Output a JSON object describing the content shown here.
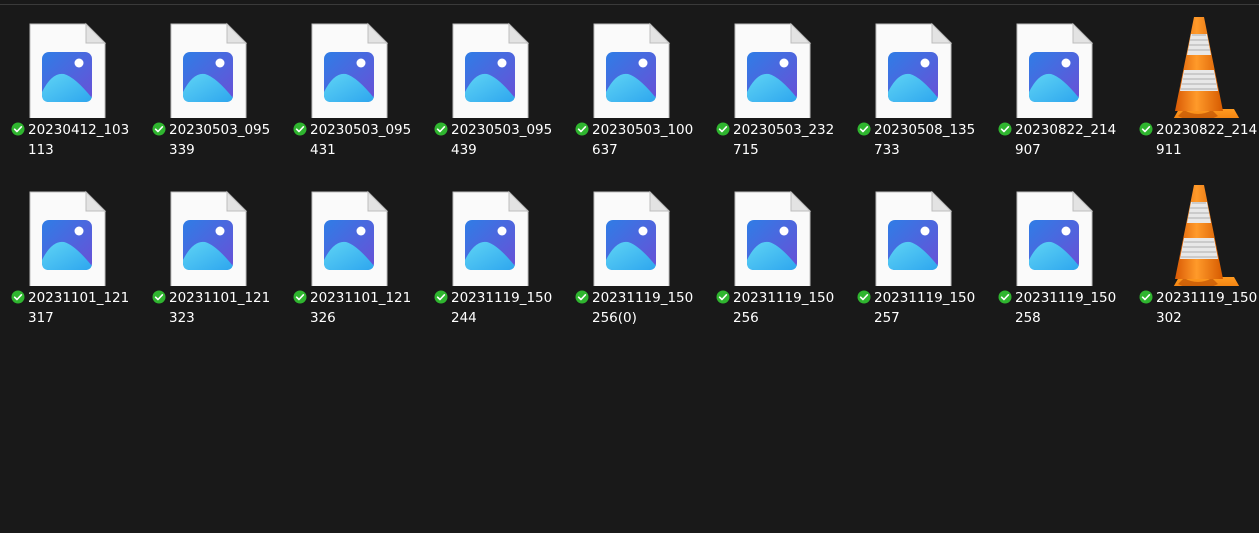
{
  "explorer": {
    "files": [
      {
        "name": "20230412_103113",
        "type": "image"
      },
      {
        "name": "20230503_095339",
        "type": "image"
      },
      {
        "name": "20230503_095431",
        "type": "image"
      },
      {
        "name": "20230503_095439",
        "type": "image"
      },
      {
        "name": "20230503_100637",
        "type": "image"
      },
      {
        "name": "20230503_232715",
        "type": "image"
      },
      {
        "name": "20230508_135733",
        "type": "image"
      },
      {
        "name": "20230822_214907",
        "type": "image"
      },
      {
        "name": "20230822_214911",
        "type": "video"
      },
      {
        "name": "20231101_121317",
        "type": "image"
      },
      {
        "name": "20231101_121323",
        "type": "image"
      },
      {
        "name": "20231101_121326",
        "type": "image"
      },
      {
        "name": "20231119_150244",
        "type": "image"
      },
      {
        "name": "20231119_150256(0)",
        "type": "image"
      },
      {
        "name": "20231119_150256",
        "type": "image"
      },
      {
        "name": "20231119_150257",
        "type": "image"
      },
      {
        "name": "20231119_150258",
        "type": "image"
      },
      {
        "name": "20231119_150302",
        "type": "video"
      }
    ],
    "status": "synced",
    "colors": {
      "background": "#191919",
      "text": "#ffffff",
      "sync_green": "#2fb52f",
      "image_accent": "#3b8ee8",
      "cone_orange": "#f07a12"
    }
  }
}
